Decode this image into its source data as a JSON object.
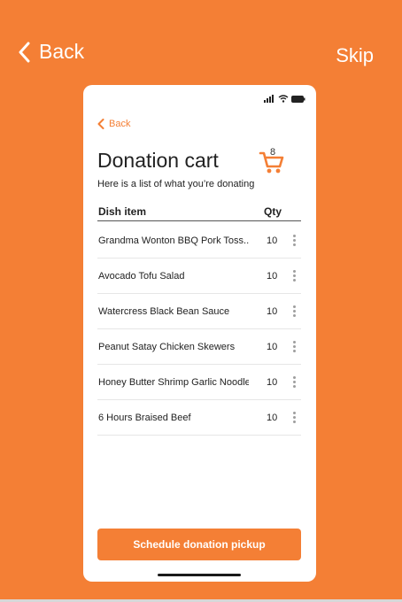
{
  "nav": {
    "back_label": "Back",
    "skip_label": "Skip"
  },
  "phone": {
    "back_label": "Back",
    "title": "Donation cart",
    "cart_count": "8",
    "subtitle": "Here is a list of what you’re donating",
    "table": {
      "headers": {
        "dish": "Dish item",
        "qty": "Qty"
      },
      "rows": [
        {
          "dish": "Grandma Wonton BBQ Pork Toss...",
          "qty": "10"
        },
        {
          "dish": "Avocado Tofu Salad",
          "qty": "10"
        },
        {
          "dish": "Watercress Black Bean Sauce",
          "qty": "10"
        },
        {
          "dish": "Peanut Satay Chicken Skewers",
          "qty": "10"
        },
        {
          "dish": "Honey Butter Shrimp Garlic Noodle",
          "qty": "10"
        },
        {
          "dish": "6 Hours Braised Beef",
          "qty": "10"
        }
      ]
    },
    "cta_label": "Schedule donation pickup"
  },
  "colors": {
    "accent": "#f47f35",
    "background": "#f47f35",
    "card": "#ffffff"
  },
  "icons": [
    "chevron-left-icon",
    "cellular-signal-icon",
    "wifi-icon",
    "battery-icon",
    "shopping-cart-icon",
    "more-vertical-icon"
  ]
}
